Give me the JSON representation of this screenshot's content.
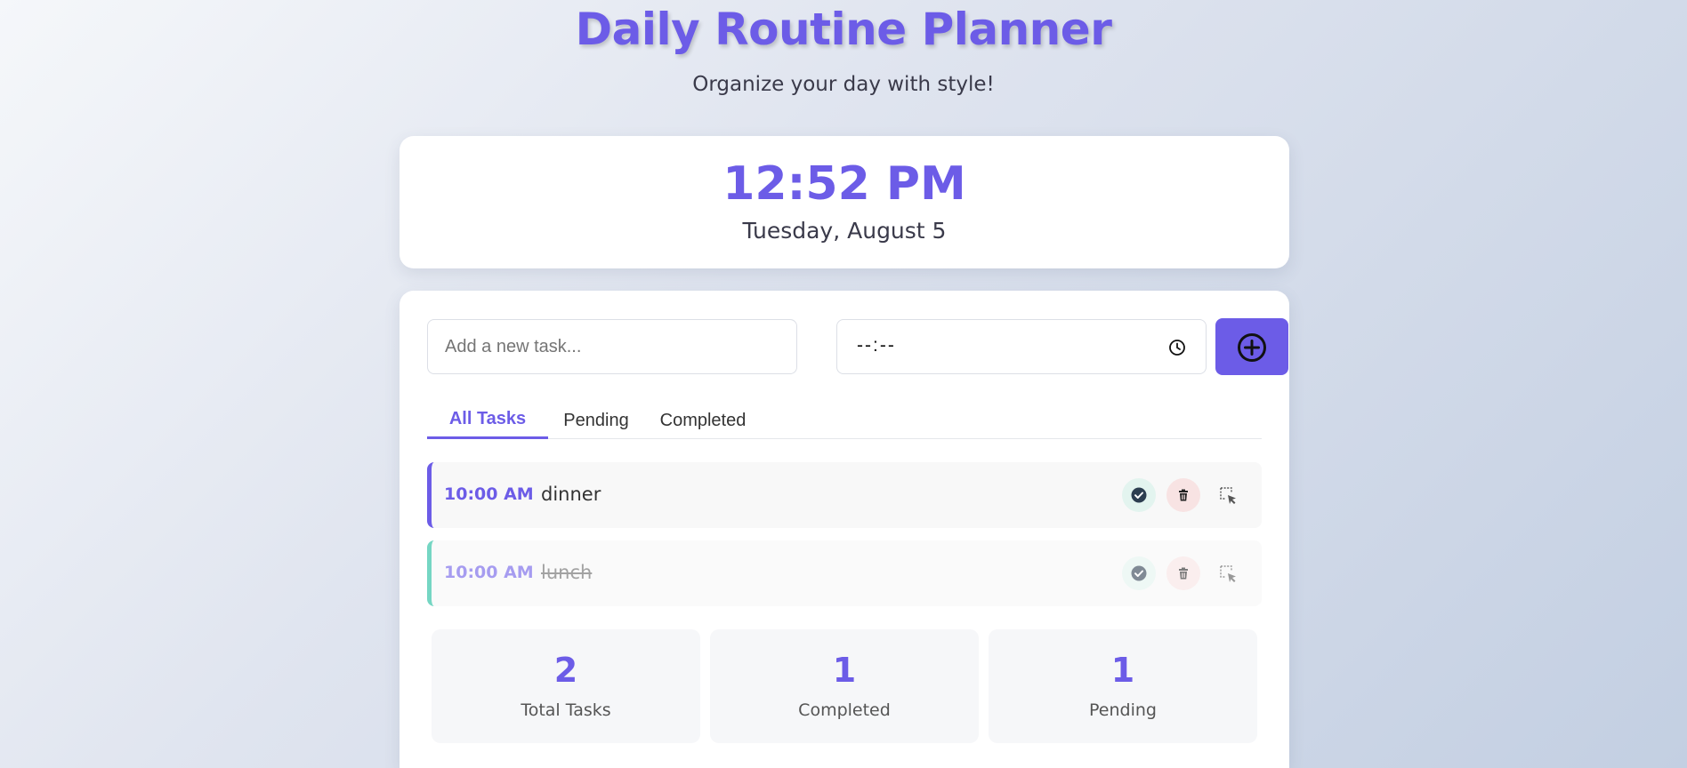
{
  "header": {
    "title": "Daily Routine Planner",
    "subtitle": "Organize your day with style!"
  },
  "clock": {
    "time": "12:52 PM",
    "date": "Tuesday, August 5"
  },
  "input": {
    "task_placeholder": "Add a new task...",
    "time_value": "--:--",
    "add_icon": "plus-circle-icon"
  },
  "tabs": [
    {
      "label": "All Tasks",
      "active": true
    },
    {
      "label": "Pending",
      "active": false
    },
    {
      "label": "Completed",
      "active": false
    }
  ],
  "tasks": [
    {
      "time": "10:00 AM",
      "name": "dinner",
      "completed": false
    },
    {
      "time": "10:00 AM",
      "name": "lunch",
      "completed": true
    }
  ],
  "stats": [
    {
      "value": "2",
      "label": "Total Tasks"
    },
    {
      "value": "1",
      "label": "Completed"
    },
    {
      "value": "1",
      "label": "Pending"
    }
  ],
  "colors": {
    "accent": "#6c5ce7",
    "completed_border": "#1abc9c",
    "complete_btn_bg": "#e3f4ef",
    "delete_btn_bg": "#f8e3e3"
  }
}
